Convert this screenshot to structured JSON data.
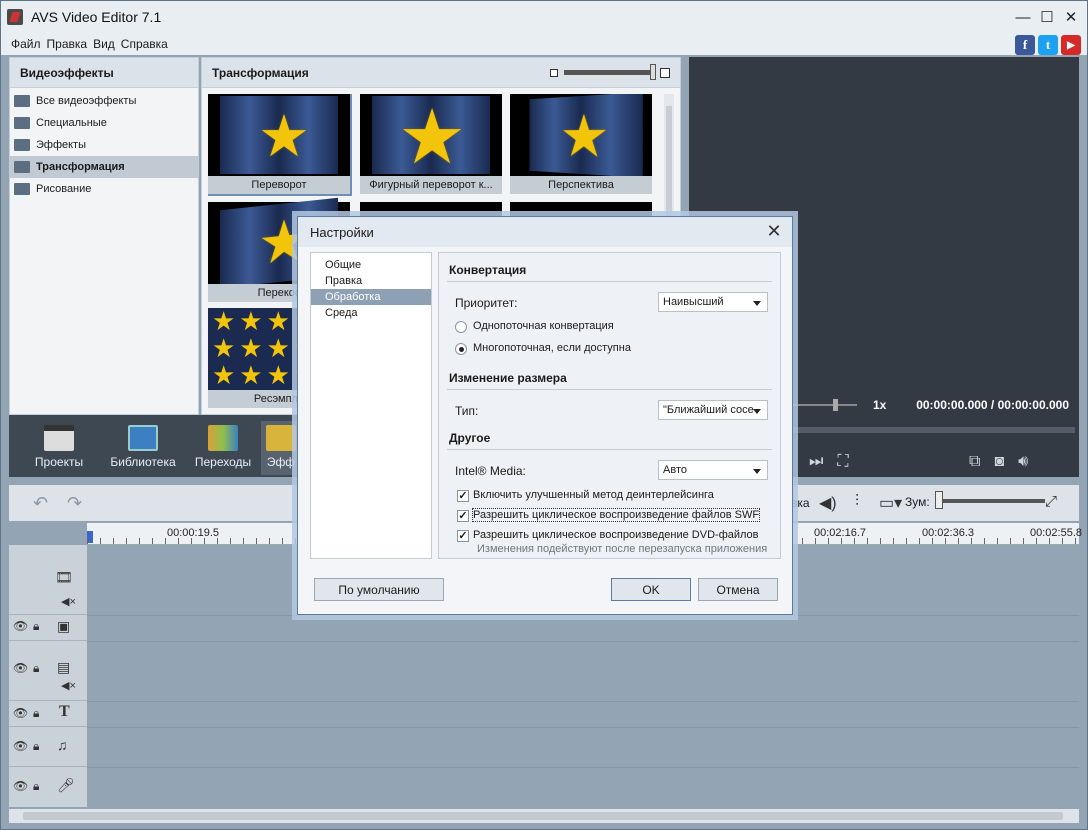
{
  "window": {
    "title": "AVS Video Editor 7.1",
    "min": "—",
    "max": "☐",
    "close": "✕"
  },
  "menu": [
    "Файл",
    "Правка",
    "Вид",
    "Справка"
  ],
  "social": {
    "facebook": "f",
    "twitter": "t",
    "youtube": "▶"
  },
  "left_panel": {
    "title": "Видеоэффекты",
    "items": [
      "Все видеоэффекты",
      "Специальные",
      "Эффекты",
      "Трансформация",
      "Рисование"
    ],
    "active_index": 3
  },
  "effects_panel": {
    "title": "Трансформация",
    "thumbnails": [
      "Переворот",
      "Фигурный переворот к...",
      "Перспектива",
      "Перекос",
      "",
      "",
      "Ресэмпли"
    ]
  },
  "preview": {
    "speed": "1x",
    "time": "00:00:00.000 / 00:00:00.000"
  },
  "toolbar": {
    "items": [
      "Проекты",
      "Библиотека",
      "Переходы",
      "Эфф"
    ]
  },
  "timeline": {
    "label_partial": "вка",
    "zoom_label": "Зум:",
    "ruler": [
      "00:00:19.5",
      "00:02:16.7",
      "00:02:36.3",
      "00:02:55.8"
    ]
  },
  "dialog": {
    "title": "Настройки",
    "nav": [
      "Общие",
      "Правка",
      "Обработка",
      "Среда"
    ],
    "nav_active": 2,
    "conversion": {
      "heading": "Конвертация",
      "priority_label": "Приоритет:",
      "priority_value": "Наивысший",
      "radio_single": "Однопоточная конвертация",
      "radio_multi": "Многопоточная, если доступна",
      "selected": "multi"
    },
    "resize": {
      "heading": "Изменение размера",
      "type_label": "Тип:",
      "type_value": "\"Ближайший сосе"
    },
    "other": {
      "heading": "Другое",
      "intel_label": "Intel® Media:",
      "intel_value": "Авто",
      "checks": [
        {
          "label": "Включить улучшенный метод деинтерлейсинга",
          "checked": true
        },
        {
          "label": "Разрешить циклическое воспроизведение файлов SWF",
          "checked": true
        },
        {
          "label": "Разрешить циклическое воспроизведение DVD-файлов",
          "checked": true
        }
      ],
      "note": "Изменения подействуют после перезапуска приложения"
    },
    "buttons": {
      "default": "По умолчанию",
      "ok": "OK",
      "cancel": "Отмена"
    }
  },
  "colors": {
    "accent": "#8ea0b4",
    "facebook": "#3b5998",
    "twitter": "#1da1f2",
    "youtube": "#d62a2a"
  }
}
